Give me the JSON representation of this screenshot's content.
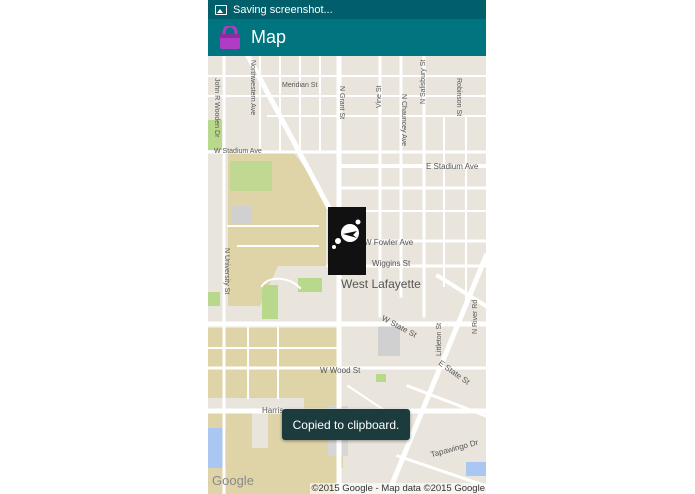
{
  "status_bar": {
    "icon": "screenshot-icon",
    "text": "Saving screenshot..."
  },
  "app_bar": {
    "icon": "lock-app-icon",
    "title": "Map"
  },
  "map": {
    "labels": {
      "meridian": "Meridian St",
      "northwestern": "Northwestern Ave",
      "john_wooden": "John R Wooden Dr",
      "n_grant": "N Grant St",
      "vine": "Vine St",
      "chauncey": "N Chauncey Ave",
      "salisbury": "N Salisbury St",
      "robinson": "Robinson St",
      "w_stadium": "W Stadium Ave",
      "e_stadium": "E Stadium Ave",
      "w_fowler": "W Fowler Ave",
      "wiggins": "Wiggins St",
      "n_university": "N University St",
      "city": "West Lafayette",
      "w_state": "W State St",
      "littleton": "Littleton St",
      "n_river": "N River Rd",
      "e_state": "E State St",
      "w_wood": "W Wood St",
      "harrison": "Harris",
      "tapawingo": "Tapawingo Dr"
    },
    "marker_icon": "bird-thought-icon",
    "google_logo": "Google",
    "attribution": "©2015 Google - Map data ©2015 Google"
  },
  "toast": {
    "text": "Copied to clipboard."
  },
  "colors": {
    "status_bar": "#005f6b",
    "app_bar": "#00747f",
    "app_icon": "#b03cc4",
    "map_bg": "#e9e5dc",
    "campus": "#dfd3a8",
    "park": "#b8d98c",
    "water": "#a9c7f2",
    "road": "#ffffff",
    "toast_bg": "#1c3b3d"
  }
}
